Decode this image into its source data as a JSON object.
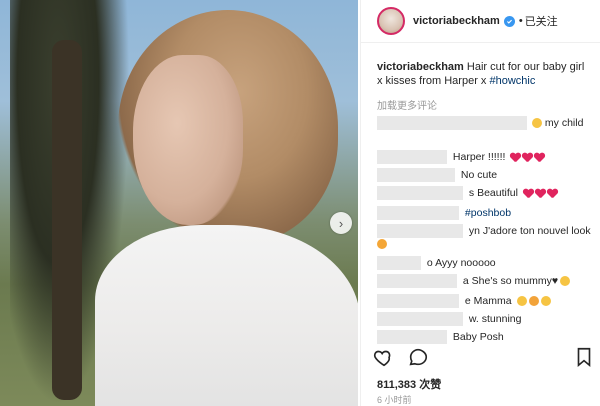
{
  "header": {
    "username": "victoriabeckham",
    "dot": "•",
    "follow_status": "已关注"
  },
  "caption": {
    "username": "victoriabeckham",
    "text": "Hair cut for our baby girl x kisses from Harper x",
    "hashtag": "#howchic"
  },
  "load_more_comments": "加载更多评论",
  "comments": [
    {
      "text": "my child"
    },
    {
      "text": "Harper !!!!!!"
    },
    {
      "text": "No cute"
    },
    {
      "text": "s Beautiful"
    },
    {
      "text": "#poshbob"
    },
    {
      "text": "yn J'adore ton nouvel look"
    },
    {
      "text": "o Ayyy nooooo"
    },
    {
      "text": "a She's so mummy♥"
    },
    {
      "text": "e Mamma"
    },
    {
      "text": "w. stunning"
    },
    {
      "text": "Baby Posh"
    }
  ],
  "likes": {
    "count": "811,383",
    "label": "次赞"
  },
  "timestamp": "6 小时前",
  "icons": {
    "like": "heart-outline-icon",
    "comment": "comment-bubble-icon",
    "save": "bookmark-icon",
    "verified": "verified-badge-icon",
    "carousel_next": "chevron-right-icon"
  },
  "colors": {
    "accent_link": "#003569",
    "verified": "#3897f0",
    "heart": "#e0245e"
  }
}
